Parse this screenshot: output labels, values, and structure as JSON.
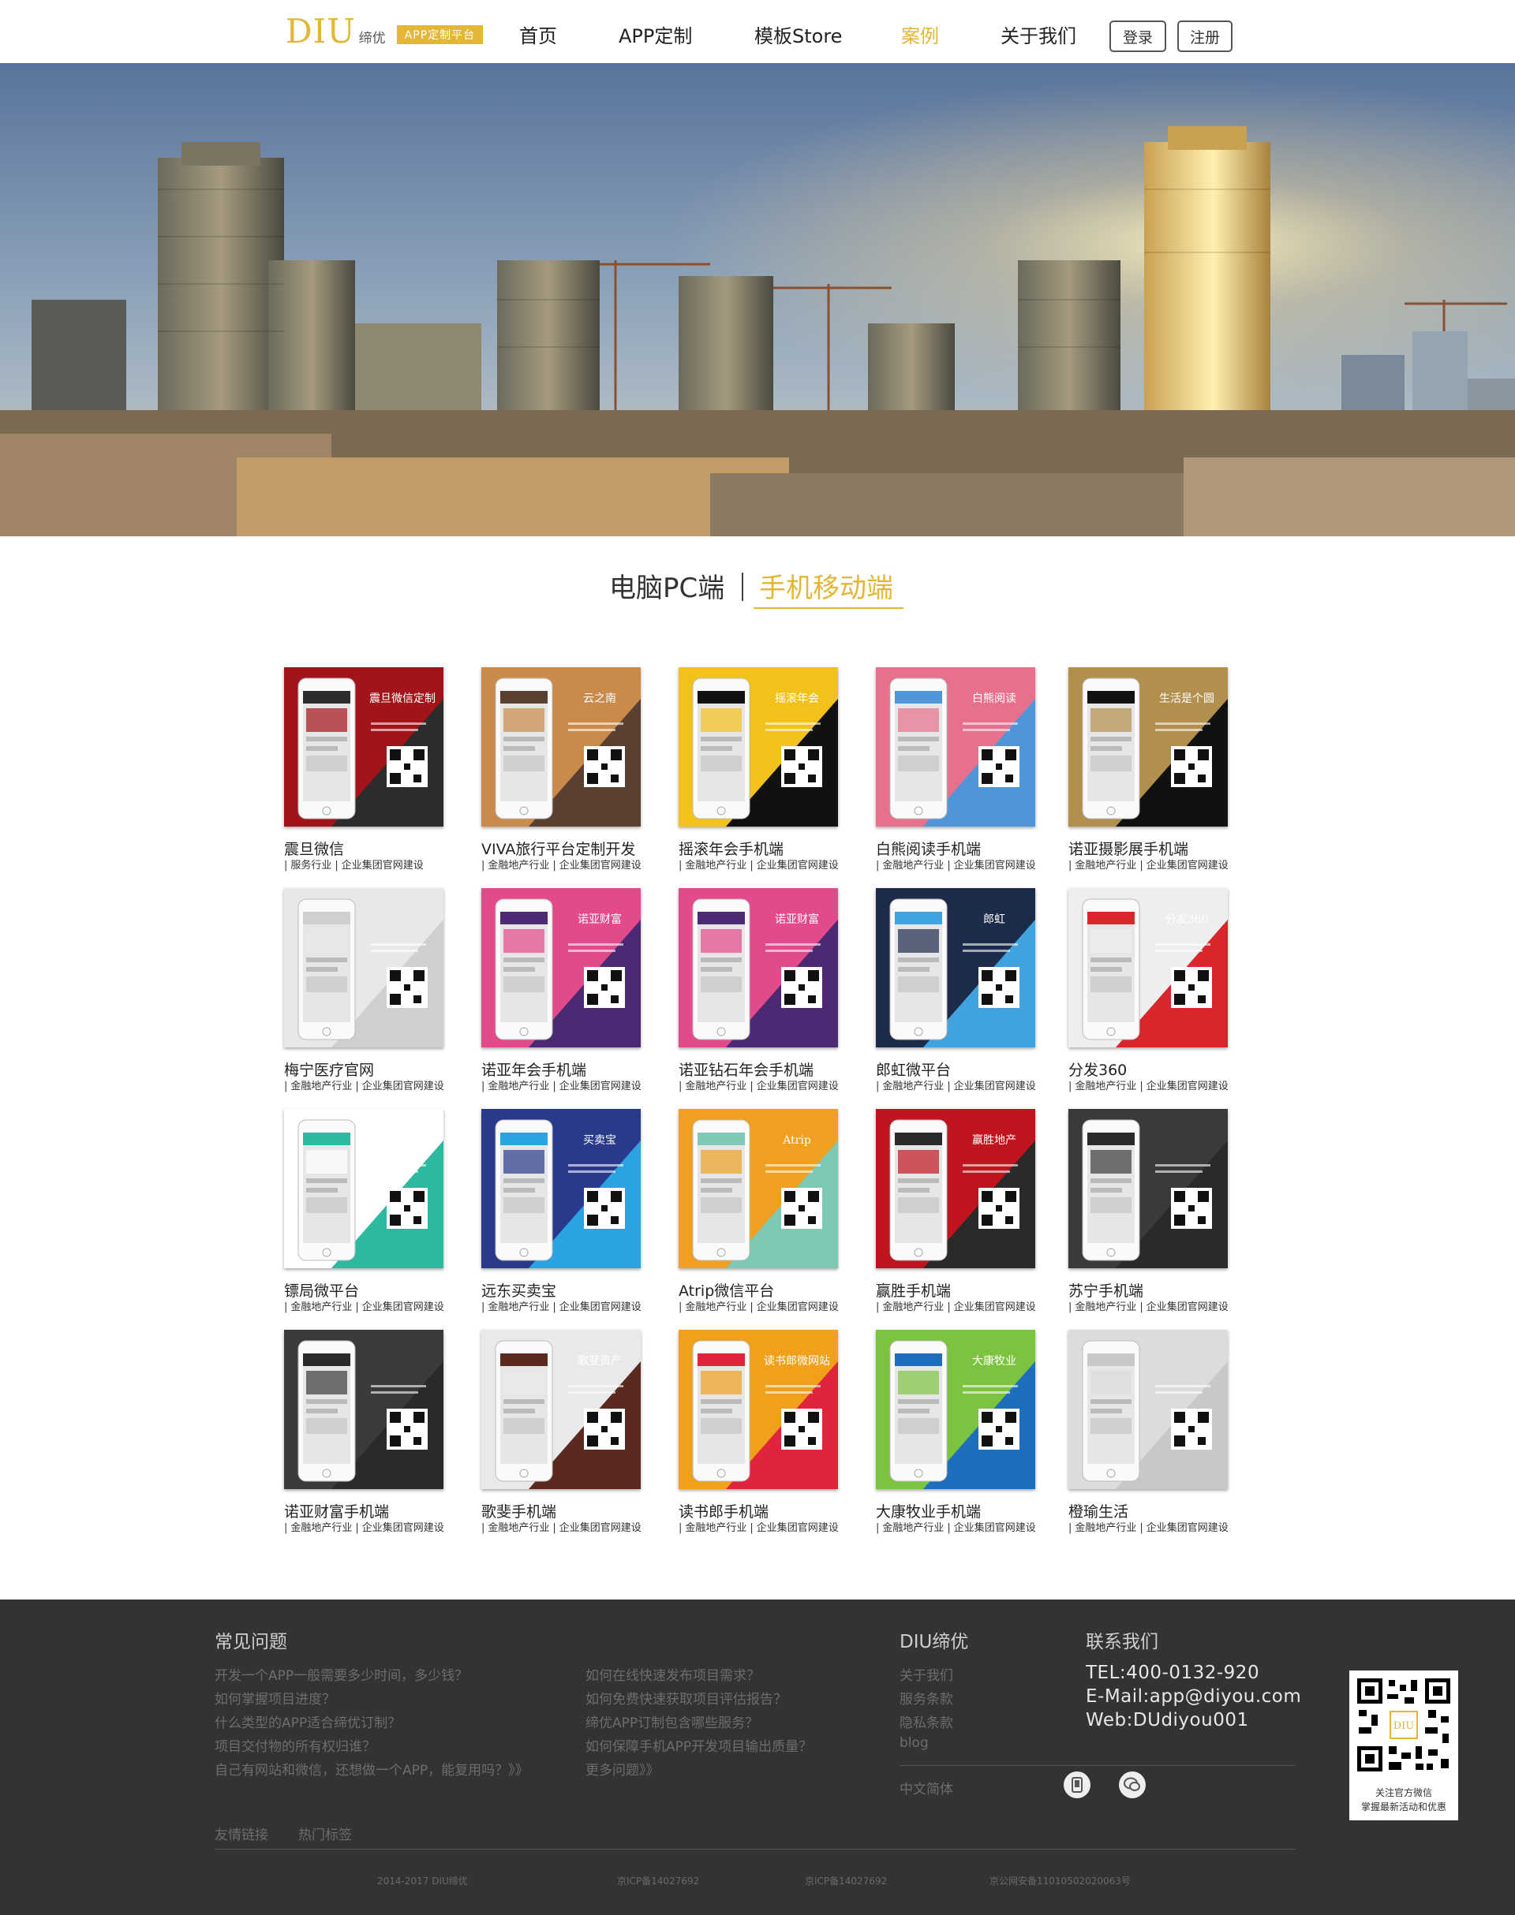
{
  "header": {
    "logo_text": "DIU",
    "logo_sub": "缔优",
    "logo_badge": "APP定制平台",
    "nav": [
      "首页",
      "APP定制",
      "模板Store",
      "案例",
      "关于我们"
    ],
    "active_nav": "案例",
    "login": "登录",
    "register": "注册"
  },
  "tabs": {
    "pc": "电脑PC端",
    "mobile": "手机移动端",
    "active": "手机移动端"
  },
  "cases": [
    {
      "title": "震旦微信",
      "tags": [
        "服务行业",
        "企业集团官网建设"
      ],
      "banner": "震旦微信定制",
      "colors": [
        "#a3131a",
        "#2c2c2c"
      ]
    },
    {
      "title": "VIVA旅行平台定制开发",
      "tags": [
        "金融地产行业",
        "企业集团官网建设"
      ],
      "banner": "云之南",
      "colors": [
        "#c98a4a",
        "#5a4030"
      ]
    },
    {
      "title": "摇滚年会手机端",
      "tags": [
        "金融地产行业",
        "企业集团官网建设"
      ],
      "banner": "摇滚年会",
      "colors": [
        "#f2c21b",
        "#111111"
      ]
    },
    {
      "title": "白熊阅读手机端",
      "tags": [
        "金融地产行业",
        "企业集团官网建设"
      ],
      "banner": "白熊阅读",
      "colors": [
        "#e7718c",
        "#4f96d8"
      ]
    },
    {
      "title": "诺亚摄影展手机端",
      "tags": [
        "金融地产行业",
        "企业集团官网建设"
      ],
      "banner": "生活是个圆",
      "colors": [
        "#b38f4d",
        "#111111"
      ]
    },
    {
      "title": "梅宁医疗官网",
      "tags": [
        "金融地产行业",
        "企业集团官网建设"
      ],
      "banner": "",
      "colors": [
        "#e8e8e8",
        "#cfcfcf"
      ]
    },
    {
      "title": "诺亚年会手机端",
      "tags": [
        "金融地产行业",
        "企业集团官网建设"
      ],
      "banner": "诺亚财富",
      "colors": [
        "#e24a8b",
        "#4b2a73"
      ]
    },
    {
      "title": "诺亚钻石年会手机端",
      "tags": [
        "金融地产行业",
        "企业集团官网建设"
      ],
      "banner": "诺亚财富",
      "colors": [
        "#e24a8b",
        "#4b2a73"
      ]
    },
    {
      "title": "郎虹微平台",
      "tags": [
        "金融地产行业",
        "企业集团官网建设"
      ],
      "banner": "郎虹",
      "colors": [
        "#1c2b4a",
        "#3fa3e0"
      ]
    },
    {
      "title": "分发360",
      "tags": [
        "金融地产行业",
        "企业集团官网建设"
      ],
      "banner": "分发360",
      "colors": [
        "#eeeeee",
        "#d9262c"
      ]
    },
    {
      "title": "镖局微平台",
      "tags": [
        "金融地产行业",
        "企业集团官网建设"
      ],
      "banner": "镖局网",
      "colors": [
        "#ffffff",
        "#2bb9a0"
      ]
    },
    {
      "title": "远东买卖宝",
      "tags": [
        "金融地产行业",
        "企业集团官网建设"
      ],
      "banner": "买卖宝",
      "colors": [
        "#2a3a8a",
        "#2aa3e3"
      ]
    },
    {
      "title": "Atrip微信平台",
      "tags": [
        "金融地产行业",
        "企业集团官网建设"
      ],
      "banner": "Atrip",
      "colors": [
        "#f0a020",
        "#7dc9b6"
      ]
    },
    {
      "title": "赢胜手机端",
      "tags": [
        "金融地产行业",
        "企业集团官网建设"
      ],
      "banner": "赢胜地产",
      "colors": [
        "#c0151f",
        "#2a2a2a"
      ]
    },
    {
      "title": "苏宁手机端",
      "tags": [
        "金融地产行业",
        "企业集团官网建设"
      ],
      "banner": "",
      "colors": [
        "#3a3a3a",
        "#2a2a2a"
      ]
    },
    {
      "title": "诺亚财富手机端",
      "tags": [
        "金融地产行业",
        "企业集团官网建设"
      ],
      "banner": "",
      "colors": [
        "#3a3a3a",
        "#2a2a2a"
      ]
    },
    {
      "title": "歌斐手机端",
      "tags": [
        "金融地产行业",
        "企业集团官网建设"
      ],
      "banner": "歌斐资产",
      "colors": [
        "#e9e9e9",
        "#5a2a20"
      ]
    },
    {
      "title": "读书郎手机端",
      "tags": [
        "金融地产行业",
        "企业集团官网建设"
      ],
      "banner": "读书郎微网站",
      "colors": [
        "#f0a01b",
        "#e0243c"
      ]
    },
    {
      "title": "大康牧业手机端",
      "tags": [
        "金融地产行业",
        "企业集团官网建设"
      ],
      "banner": "大康牧业",
      "colors": [
        "#7cc440",
        "#1e6ebf"
      ]
    },
    {
      "title": "橙瑜生活",
      "tags": [
        "金融地产行业",
        "企业集团官网建设"
      ],
      "banner": "",
      "colors": [
        "#dcdcdc",
        "#c8c8c8"
      ]
    }
  ],
  "footer": {
    "faq_title": "常见问题",
    "faq_left": [
      "开发一个APP一般需要多少时间，多少钱？",
      "如何掌握项目进度？",
      "什么类型的APP适合缔优订制？",
      "项目交付物的所有权归谁？",
      "自己有网站和微信，还想做一个APP，能复用吗？》》"
    ],
    "faq_right": [
      "如何在线快速发布项目需求？",
      "如何免费快速获取项目评估报告？",
      "缔优APP订制包含哪些服务？",
      "如何保障手机APP开发项目输出质量？",
      "更多问题》》"
    ],
    "diu_title": "DIU缔优",
    "diu_links": [
      "关于我们",
      "服务条款",
      "隐私条款",
      "blog"
    ],
    "contact_title": "联系我们",
    "tel": "TEL:400-0132-920",
    "email": "E-Mail:app@diyou.com",
    "web": "Web:DUdiyou001",
    "language": "中文简体",
    "qr_line1": "关注官方微信",
    "qr_line2": "掌握最新活动和优惠",
    "bottom_links": [
      "友情链接",
      "热门标签"
    ],
    "copyright": [
      "2014-2017    DIU缔优",
      "京ICP备14027692",
      "京ICP备14027692",
      "京公网安备11010502020063号"
    ]
  }
}
